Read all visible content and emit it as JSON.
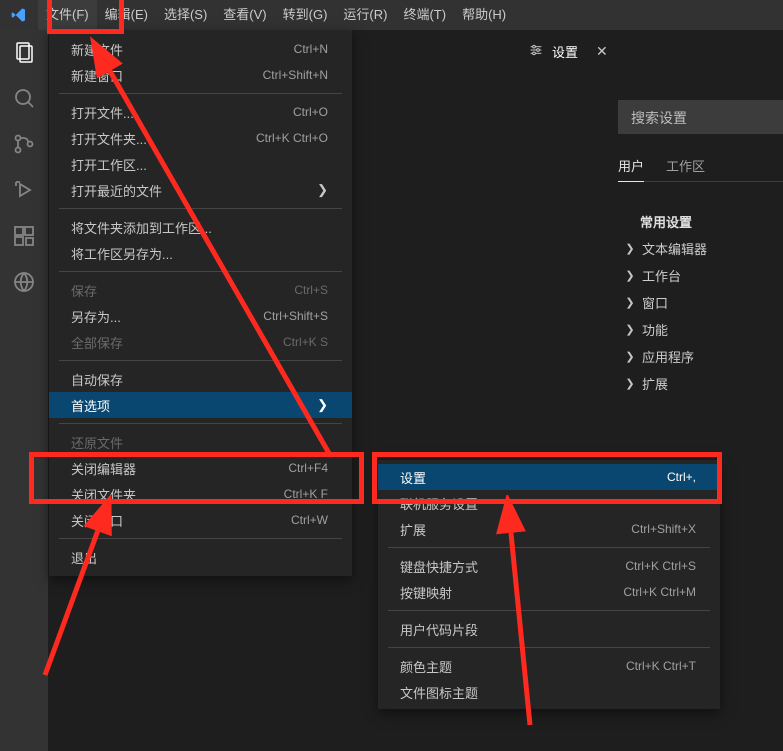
{
  "menubar": {
    "items": [
      {
        "label": "文件(F)",
        "open": true
      },
      {
        "label": "编辑(E)"
      },
      {
        "label": "选择(S)"
      },
      {
        "label": "查看(V)"
      },
      {
        "label": "转到(G)"
      },
      {
        "label": "运行(R)"
      },
      {
        "label": "终端(T)"
      },
      {
        "label": "帮助(H)"
      }
    ]
  },
  "activity": {
    "icons": [
      "explorer-icon",
      "search-icon",
      "scm-icon",
      "debug-icon",
      "extensions-icon",
      "remote-icon"
    ]
  },
  "file_menu": [
    {
      "label": "新建文件",
      "accel": "Ctrl+N"
    },
    {
      "label": "新建窗口",
      "accel": "Ctrl+Shift+N"
    },
    {
      "sep": true
    },
    {
      "label": "打开文件...",
      "accel": "Ctrl+O"
    },
    {
      "label": "打开文件夹...",
      "accel": "Ctrl+K Ctrl+O"
    },
    {
      "label": "打开工作区..."
    },
    {
      "label": "打开最近的文件",
      "submenu": true
    },
    {
      "sep": true
    },
    {
      "label": "将文件夹添加到工作区..."
    },
    {
      "label": "将工作区另存为..."
    },
    {
      "sep": true
    },
    {
      "label": "保存",
      "accel": "Ctrl+S",
      "disabled": true
    },
    {
      "label": "另存为...",
      "accel": "Ctrl+Shift+S"
    },
    {
      "label": "全部保存",
      "accel": "Ctrl+K S",
      "disabled": true
    },
    {
      "sep": true
    },
    {
      "label": "自动保存"
    },
    {
      "label": "首选项",
      "submenu": true,
      "selected": true
    },
    {
      "sep": true
    },
    {
      "label": "还原文件",
      "disabled": true
    },
    {
      "label": "关闭编辑器",
      "accel": "Ctrl+F4"
    },
    {
      "label": "关闭文件夹",
      "accel": "Ctrl+K F"
    },
    {
      "label": "关闭窗口",
      "accel": "Ctrl+W"
    },
    {
      "sep": true
    },
    {
      "label": "退出"
    }
  ],
  "prefs_submenu": [
    {
      "label": "设置",
      "accel": "Ctrl+,",
      "selected": true
    },
    {
      "label": "联机服务设置"
    },
    {
      "label": "扩展",
      "accel": "Ctrl+Shift+X"
    },
    {
      "sep": true
    },
    {
      "label": "键盘快捷方式",
      "accel": "Ctrl+K Ctrl+S"
    },
    {
      "label": "按键映射",
      "accel": "Ctrl+K Ctrl+M"
    },
    {
      "sep": true
    },
    {
      "label": "用户代码片段"
    },
    {
      "sep": true
    },
    {
      "label": "颜色主题",
      "accel": "Ctrl+K Ctrl+T"
    },
    {
      "label": "文件图标主题"
    }
  ],
  "settings_tab": {
    "title": "设置",
    "search_placeholder": "搜索设置",
    "scope_tabs": [
      "用户",
      "工作区"
    ],
    "nav_header": "常用设置",
    "nav_items": [
      "文本编辑器",
      "工作台",
      "窗口",
      "功能",
      "应用程序",
      "扩展"
    ]
  }
}
